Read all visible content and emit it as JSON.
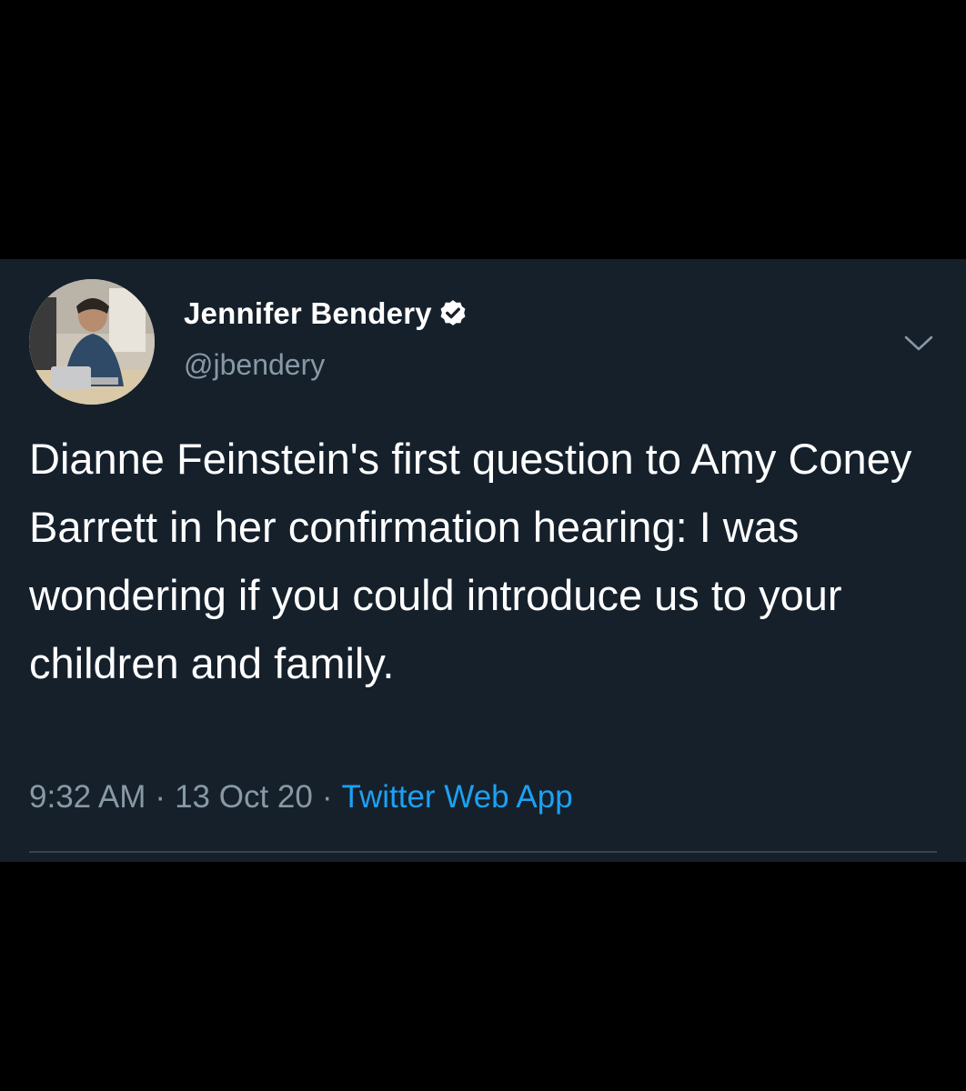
{
  "tweet": {
    "author": {
      "display_name": "Jennifer Bendery",
      "handle": "@jbendery",
      "verified": true
    },
    "text": "Dianne Feinstein's first question to Amy Coney Barrett in her confirmation hearing: I was wondering if you could introduce us to your children and family.",
    "time": "9:32 AM",
    "date": "13 Oct 20",
    "separator": "·",
    "source": "Twitter Web App"
  },
  "icons": {
    "verified": "verified-badge-icon",
    "menu": "chevron-down-icon"
  },
  "colors": {
    "card_background": "#15202b",
    "page_background": "#000000",
    "primary_text": "#ffffff",
    "secondary_text": "#8899a6",
    "link": "#1da1f2",
    "divider": "#38444d"
  }
}
